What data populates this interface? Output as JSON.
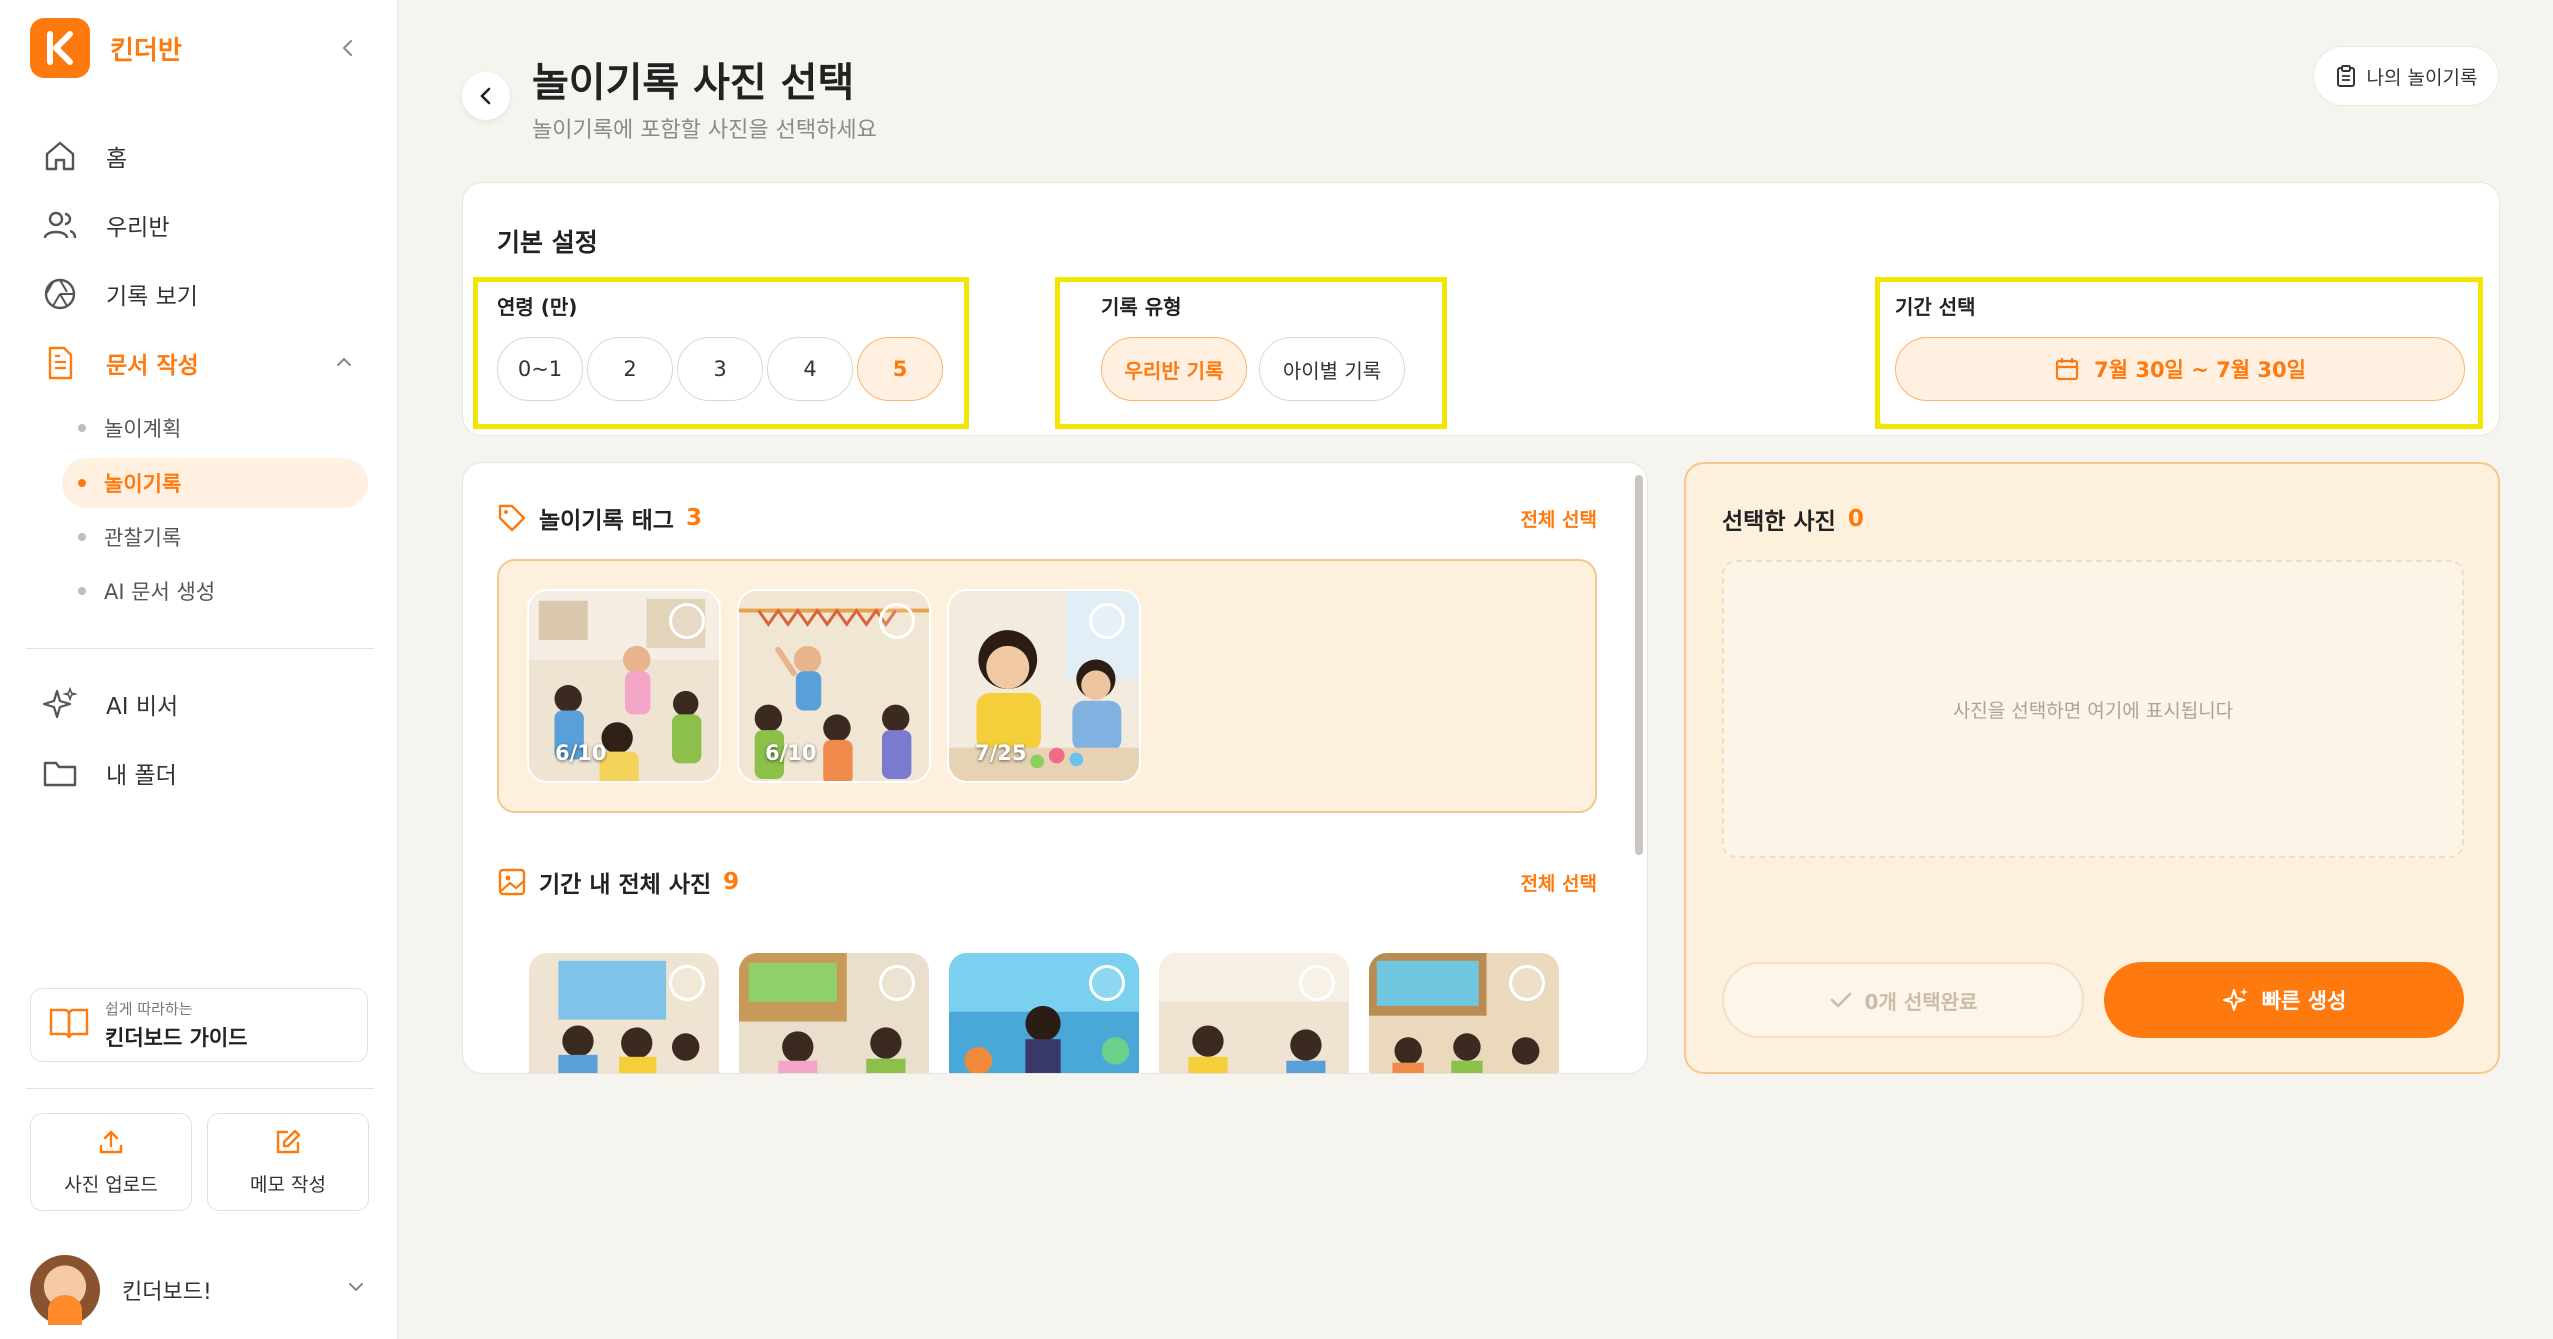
{
  "brand": {
    "name": "킨더반"
  },
  "nav": {
    "home": "홈",
    "our_class": "우리반",
    "view_records": "기록 보기",
    "write_docs": "문서 작성",
    "sub_items": [
      "놀이계획",
      "놀이기록",
      "관찰기록",
      "AI 문서 생성"
    ],
    "ai_assistant": "AI 비서",
    "my_folder": "내 폴더"
  },
  "guide": {
    "small": "쉽게 따라하는",
    "big": "킨더보드 가이드"
  },
  "quick_actions": {
    "upload": "사진 업로드",
    "memo": "메모 작성"
  },
  "profile": {
    "name": "킨더보드!"
  },
  "header": {
    "title": "놀이기록 사진 선택",
    "subtitle": "놀이기록에 포함할 사진을 선택하세요",
    "my_records": "나의 놀이기록"
  },
  "settings": {
    "title": "기본 설정",
    "age_label": "연령 (만)",
    "ages": [
      "0~1",
      "2",
      "3",
      "4",
      "5"
    ],
    "selected_age": "5",
    "type_label": "기록 유형",
    "types": [
      "우리반 기록",
      "아이별 기록"
    ],
    "selected_type": "우리반 기록",
    "period_label": "기간 선택",
    "period_value": "7월 30일 ~ 7월 30일"
  },
  "tag_section": {
    "title": "놀이기록 태그",
    "count": "3",
    "select_all": "전체 선택",
    "photos": [
      {
        "date": "6/10"
      },
      {
        "date": "6/10"
      },
      {
        "date": "7/25"
      }
    ]
  },
  "all_section": {
    "title": "기간 내 전체 사진",
    "count": "9",
    "select_all": "전체 선택"
  },
  "selected": {
    "title": "선택한 사진",
    "count": "0",
    "empty_text": "사진을 선택하면 여기에 표시됩니다",
    "done_label": "0개 선택완료",
    "generate_label": "빠른 생성"
  },
  "colors": {
    "accent": "#ff7a0e",
    "highlight": "#f2e600",
    "panel": "#fdf0dd"
  }
}
